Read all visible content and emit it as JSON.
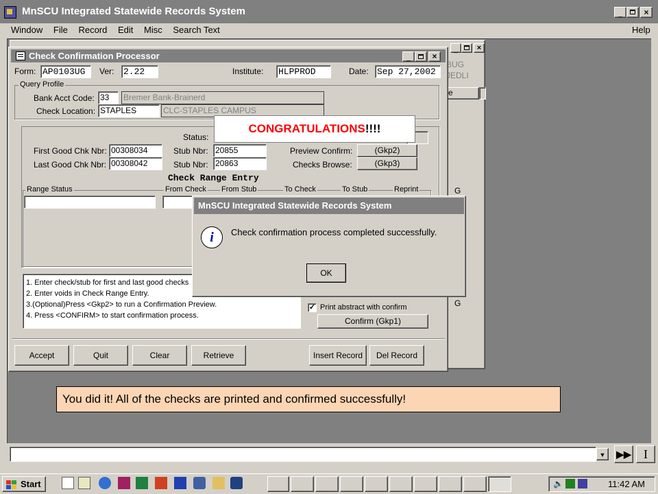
{
  "app": {
    "title": "MnSCU Integrated Statewide Records System",
    "menu": [
      "Window",
      "File",
      "Record",
      "Edit",
      "Misc",
      "Search Text"
    ],
    "help": "Help"
  },
  "form": {
    "title": "Check Confirmation Processor",
    "form_label": "Form:",
    "form_value": "AP0103UG",
    "ver_label": "Ver:",
    "ver_value": "2.22",
    "institute_label": "Institute:",
    "institute_value": "HLPPROD",
    "date_label": "Date:",
    "date_value": "Sep 27,2002",
    "query_profile": "Query Profile",
    "bank_label": "Bank Acct Code:",
    "bank_code": "33",
    "bank_name": "Bremer Bank-Brainerd",
    "location_label": "Check Location:",
    "location_code": "STAPLES",
    "location_name": "CLC-STAPLES CAMPUS",
    "status_label": "Status:",
    "first_label": "First Good Chk Nbr:",
    "first_value": "00308034",
    "last_label": "Last Good Chk Nbr:",
    "last_value": "00308042",
    "stub_label": "Stub Nbr:",
    "stub1": "20855",
    "stub2": "20863",
    "preview_label": "Preview Confirm:",
    "preview_btn": "(Gkp2)",
    "browse_label": "Checks Browse:",
    "browse_btn": "(Gkp3)",
    "range_title": "Check Range Entry",
    "col_range_status": "Range Status",
    "col_from_check": "From Check",
    "col_from_stub": "From Stub",
    "col_to_check": "To Check",
    "col_to_stub": "To Stub",
    "col_reprint": "Reprint",
    "instructions": [
      "1. Enter check/stub for first and last good checks",
      "2. Enter voids in Check Range Entry.",
      "3.(Optional)Press <Gkp2> to run a Confirmation Preview.",
      "4. Press <CONFIRM> to start confirmation process."
    ],
    "print_abstract": "Print abstract with confirm",
    "confirm_btn": "Confirm (Gkp1)",
    "buttons": [
      "Accept",
      "Quit",
      "Clear",
      "Retrieve",
      "Insert Record",
      "Del Record"
    ]
  },
  "background_window": {
    "text1": "BUG",
    "text2": "JEDLI",
    "col": "e",
    "g1": "G",
    "g2": "G"
  },
  "dialog": {
    "title": "MnSCU Integrated Statewide Records System",
    "message": "Check confirmation process completed successfully.",
    "ok": "OK"
  },
  "callouts": {
    "congrats_main": "CONGRATULATIONS",
    "congrats_tail": "!!!!",
    "success": "You did it!  All of the checks are printed and confirmed successfully!",
    "congrats_color": "#ff0000",
    "success_bg": "#fcd5b4"
  },
  "taskbar": {
    "start": "Start",
    "time": "11:42 AM"
  }
}
